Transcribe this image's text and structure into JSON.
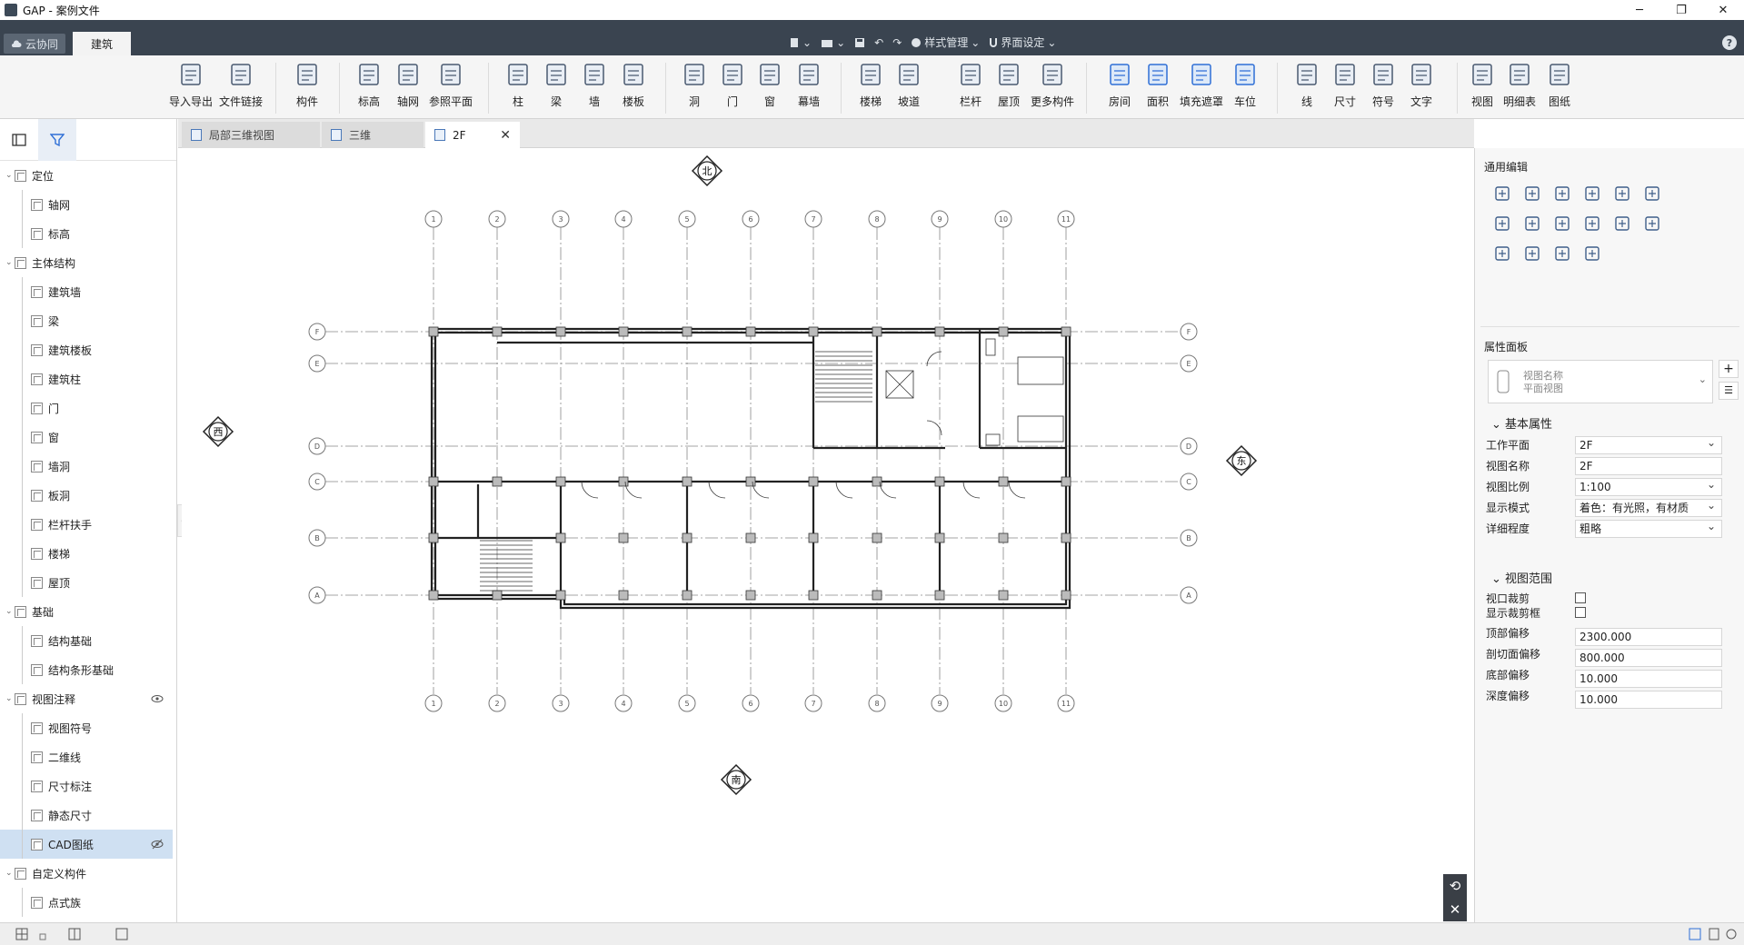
{
  "window": {
    "title": "GAP - 案例文件",
    "min": "─",
    "restore": "❐",
    "close": "✕"
  },
  "tabbar": {
    "cloud": "云协同",
    "active_tab": "建筑",
    "undo": "↶",
    "redo": "↷",
    "style_mgmt": "样式管理",
    "ui_settings": "界面设定",
    "help": "?"
  },
  "ribbon": [
    {
      "label": "导入导出",
      "icon": "cad-import-icon"
    },
    {
      "label": "文件链接",
      "icon": "file-link-icon"
    },
    {
      "label": "构件",
      "icon": "component-icon"
    },
    {
      "label": "标高",
      "icon": "level-icon"
    },
    {
      "label": "轴网",
      "icon": "grid-icon"
    },
    {
      "label": "参照平面",
      "icon": "reference-plane-icon"
    },
    {
      "label": "柱",
      "icon": "column-icon"
    },
    {
      "label": "梁",
      "icon": "beam-icon"
    },
    {
      "label": "墙",
      "icon": "wall-icon"
    },
    {
      "label": "楼板",
      "icon": "floor-icon"
    },
    {
      "label": "洞",
      "icon": "opening-icon"
    },
    {
      "label": "门",
      "icon": "door-icon"
    },
    {
      "label": "窗",
      "icon": "window-icon"
    },
    {
      "label": "幕墙",
      "icon": "curtain-wall-icon"
    },
    {
      "label": "楼梯",
      "icon": "stair-icon"
    },
    {
      "label": "坡道",
      "icon": "ramp-icon"
    },
    {
      "label": "栏杆",
      "icon": "railing-icon"
    },
    {
      "label": "屋顶",
      "icon": "roof-icon"
    },
    {
      "label": "更多构件",
      "icon": "more-components-icon"
    },
    {
      "label": "房间",
      "icon": "room-icon"
    },
    {
      "label": "面积",
      "icon": "area-icon"
    },
    {
      "label": "填充遮罩",
      "icon": "fill-mask-icon"
    },
    {
      "label": "车位",
      "icon": "parking-icon"
    },
    {
      "label": "线",
      "icon": "line-icon"
    },
    {
      "label": "尺寸",
      "icon": "dimension-icon"
    },
    {
      "label": "符号",
      "icon": "symbol-icon"
    },
    {
      "label": "文字",
      "icon": "text-icon"
    },
    {
      "label": "视图",
      "icon": "view-icon"
    },
    {
      "label": "明细表",
      "icon": "schedule-icon"
    },
    {
      "label": "图纸",
      "icon": "sheet-icon"
    }
  ],
  "tree": [
    {
      "label": "定位",
      "level": 1
    },
    {
      "label": "轴网",
      "level": 2
    },
    {
      "label": "标高",
      "level": 2
    },
    {
      "label": "主体结构",
      "level": 1
    },
    {
      "label": "建筑墙",
      "level": 2
    },
    {
      "label": "梁",
      "level": 2
    },
    {
      "label": "建筑楼板",
      "level": 2
    },
    {
      "label": "建筑柱",
      "level": 2
    },
    {
      "label": "门",
      "level": 2
    },
    {
      "label": "窗",
      "level": 2
    },
    {
      "label": "墙洞",
      "level": 2
    },
    {
      "label": "板洞",
      "level": 2
    },
    {
      "label": "栏杆扶手",
      "level": 2
    },
    {
      "label": "楼梯",
      "level": 2
    },
    {
      "label": "屋顶",
      "level": 2
    },
    {
      "label": "基础",
      "level": 1
    },
    {
      "label": "结构基础",
      "level": 2
    },
    {
      "label": "结构条形基础",
      "level": 2
    },
    {
      "label": "视图注释",
      "level": 1
    },
    {
      "label": "视图符号",
      "level": 2
    },
    {
      "label": "二维线",
      "level": 2
    },
    {
      "label": "尺寸标注",
      "level": 2
    },
    {
      "label": "静态尺寸",
      "level": 2
    },
    {
      "label": "CAD图纸",
      "level": 2
    },
    {
      "label": "自定义构件",
      "level": 1
    },
    {
      "label": "点式族",
      "level": 2
    }
  ],
  "doc_tabs": [
    "局部三维视图",
    "三维",
    "2F"
  ],
  "compass": {
    "north": "北",
    "south": "南",
    "west": "西",
    "east": "东"
  },
  "grid": {
    "x_labels": [
      "1",
      "2",
      "3",
      "4",
      "5",
      "6",
      "7",
      "8",
      "9",
      "10",
      "11"
    ],
    "y_labels": [
      "F",
      "E",
      "D",
      "C",
      "B",
      "A"
    ]
  },
  "right": {
    "edit_title": "通用编辑",
    "prop_title": "属性面板",
    "type_name": "视图名称",
    "type_sub": "平面视图",
    "basic_group": "基本属性",
    "props": [
      {
        "label": "工作平面",
        "value": "2F"
      },
      {
        "label": "视图名称",
        "value": "2F"
      },
      {
        "label": "视图比例",
        "value": "1:100"
      },
      {
        "label": "显示模式",
        "value": "着色：有光照，有材质"
      },
      {
        "label": "详细程度",
        "value": "粗略"
      }
    ],
    "range_group": "视图范围",
    "checks": [
      {
        "label": "视口裁剪",
        "checked": false
      },
      {
        "label": "显示裁剪框",
        "checked": false
      }
    ],
    "offsets": [
      {
        "label": "顶部偏移",
        "value": "2300.000"
      },
      {
        "label": "剖切面偏移",
        "value": "800.000"
      },
      {
        "label": "底部偏移",
        "value": "10.000"
      },
      {
        "label": "深度偏移",
        "value": "10.000"
      }
    ]
  }
}
